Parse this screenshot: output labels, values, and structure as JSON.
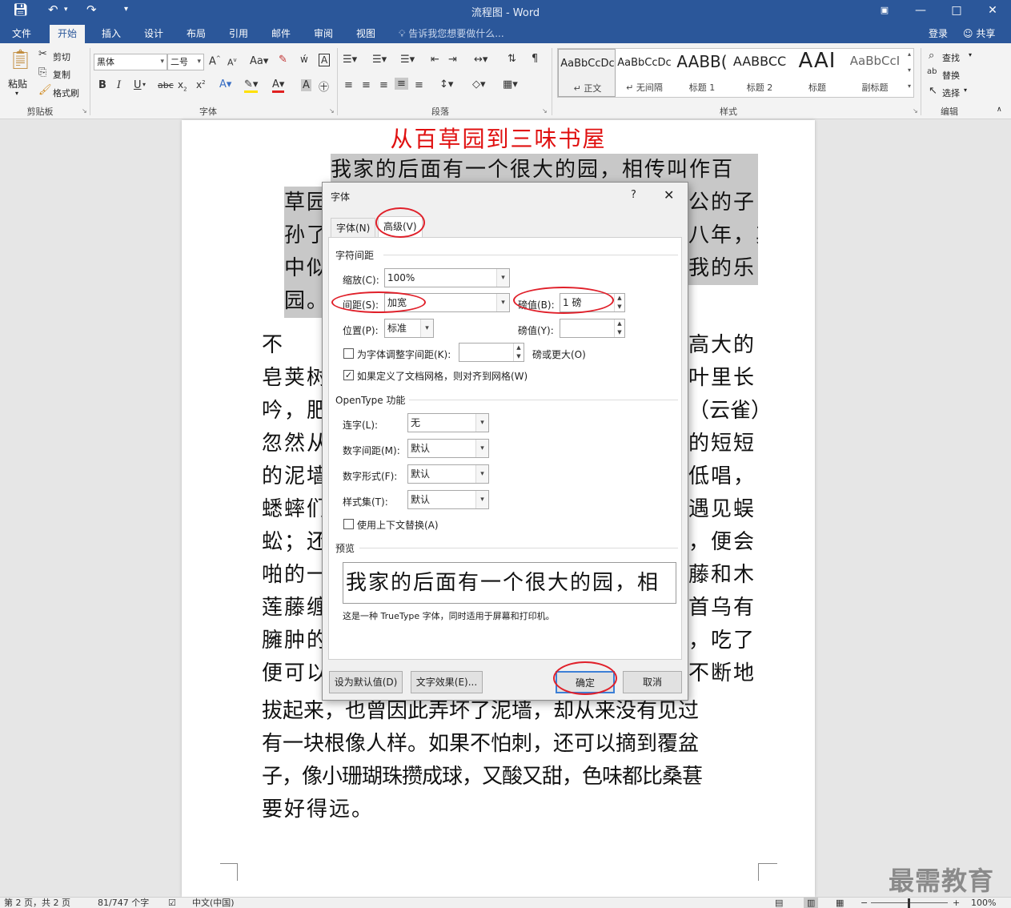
{
  "app": {
    "window_title": "流程图 - Word",
    "quick_access": [
      "save-icon",
      "undo-icon",
      "redo-icon",
      "customize-icon"
    ]
  },
  "tabs": [
    {
      "label": "文件"
    },
    {
      "label": "开始"
    },
    {
      "label": "插入"
    },
    {
      "label": "设计"
    },
    {
      "label": "布局"
    },
    {
      "label": "引用"
    },
    {
      "label": "邮件"
    },
    {
      "label": "审阅"
    },
    {
      "label": "视图"
    }
  ],
  "tell_me": "告诉我您想要做什么...",
  "sign_in": "登录",
  "share": "共享",
  "ribbon": {
    "clipboard": {
      "paste": "粘贴",
      "cut": "剪切",
      "copy": "复制",
      "format_painter": "格式刷",
      "group": "剪贴板"
    },
    "font": {
      "name": "黑体",
      "size": "二号",
      "group": "字体"
    },
    "paragraph": {
      "group": "段落"
    },
    "styles": {
      "group": "样式",
      "items": [
        {
          "sample": "AaBbCcDc",
          "name": "↵ 正文"
        },
        {
          "sample": "AaBbCcDc",
          "name": "↵ 无间隔"
        },
        {
          "sample": "AABB(",
          "name": "标题 1"
        },
        {
          "sample": "AABBCC",
          "name": "标题 2"
        },
        {
          "sample": "AAI",
          "name": "标题"
        },
        {
          "sample": "AaBbCcI",
          "name": "副标题"
        }
      ]
    },
    "editing": {
      "find": "查找",
      "replace": "替换",
      "select": "选择",
      "group": "编辑"
    }
  },
  "document": {
    "title": "从百草园到三味书屋",
    "lines": [
      {
        "left": "我家的后面有一个很大的园，相传叫作百",
        "right": ""
      },
      {
        "left": "草园",
        "right": "公的子"
      },
      {
        "left": "孙了",
        "right": "八年，其"
      },
      {
        "left": "中似",
        "right": "我的乐"
      },
      {
        "left": "园。",
        "right": ""
      },
      {
        "left": "    不",
        "right": "高大的"
      },
      {
        "left": "皂荚树",
        "right": "叶里长"
      },
      {
        "left": "吟，肥",
        "right": "（云雀）"
      },
      {
        "left": "忽然从",
        "right": "的短短"
      },
      {
        "left": "的泥墙",
        "right": "低唱，"
      },
      {
        "left": "蟋蟀们",
        "right": "遇见蜈"
      },
      {
        "left": "蚣；还",
        "right": "，便会"
      },
      {
        "left": "啪的一",
        "right": "藤和木"
      },
      {
        "left": "莲藤缠",
        "right": "首乌有"
      },
      {
        "left": "臃肿的",
        "right": "，吃了"
      },
      {
        "left": "便可以",
        "right": "不断地"
      },
      {
        "left": "拔起来，也曾因此弄坏了泥墙，却从来没有见过",
        "right": ""
      },
      {
        "left": "有一块根像人样。如果不怕刺，还可以摘到覆盆",
        "right": ""
      },
      {
        "left": "子，像小珊瑚珠攒成球，又酸又甜，色味都比桑葚",
        "right": ""
      },
      {
        "left": "要好得远。",
        "right": ""
      }
    ]
  },
  "status": {
    "page": "第 2 页，共 2 页",
    "words": "81/747 个字",
    "language": "中文(中国)",
    "zoom": "100%"
  },
  "watermark": "最需教育",
  "dialog": {
    "title": "字体",
    "help": "?",
    "tab_font": "字体(N)",
    "tab_advanced": "高级(V)",
    "spacing_section": "字符间距",
    "scale_label": "缩放(C):",
    "scale_value": "100%",
    "spacing_label": "间距(S):",
    "spacing_value": "加宽",
    "spacing_by_label": "磅值(B):",
    "spacing_by_value": "1 磅",
    "position_label": "位置(P):",
    "position_value": "标准",
    "position_by_label": "磅值(Y):",
    "position_by_value": "",
    "kerning_label": "为字体调整字间距(K):",
    "kerning_value": "",
    "kerning_suffix": "磅或更大(O)",
    "kerning_checked": false,
    "grid_label": "如果定义了文档网格，则对齐到网格(W)",
    "grid_checked": true,
    "opentype_section": "OpenType 功能",
    "ligatures_label": "连字(L):",
    "ligatures_value": "无",
    "num_spacing_label": "数字间距(M):",
    "num_spacing_value": "默认",
    "num_forms_label": "数字形式(F):",
    "num_forms_value": "默认",
    "stylistic_label": "样式集(T):",
    "stylistic_value": "默认",
    "contextual_label": "使用上下文替换(A)",
    "contextual_checked": false,
    "preview_section": "预览",
    "preview_text": "我家的后面有一个很大的园，相",
    "preview_note": "这是一种 TrueType 字体，同时适用于屏幕和打印机。",
    "set_default": "设为默认值(D)",
    "text_effects": "文字效果(E)...",
    "ok": "确定",
    "cancel": "取消"
  },
  "colors": {
    "ribbon_blue": "#2b579a",
    "title_red": "#e01010",
    "highlight": "#e0202a",
    "selection": "#c8c8c8"
  }
}
